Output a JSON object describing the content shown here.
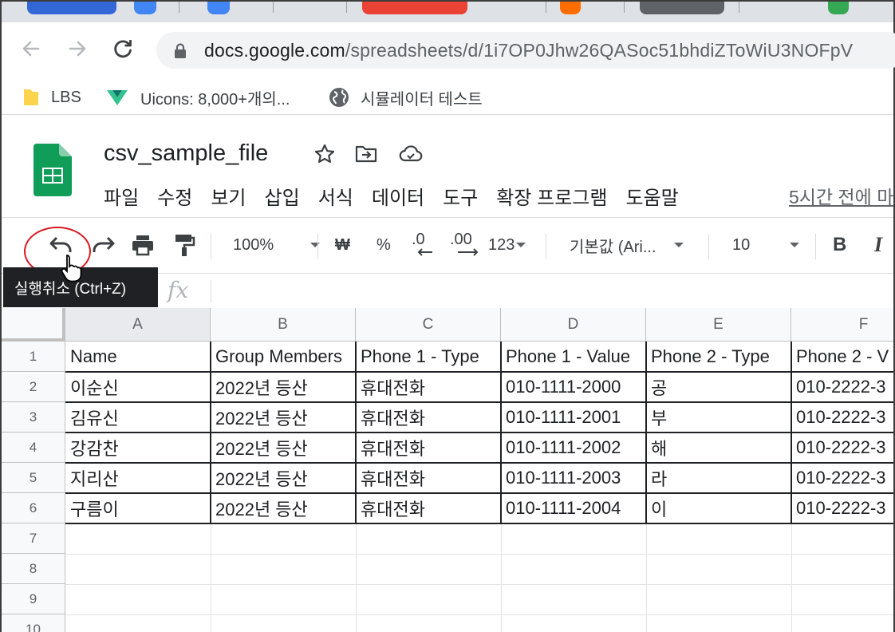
{
  "browser": {
    "url_host": "docs.google.com",
    "url_path": "/spreadsheets/d/1i7OP0Jhw26QASoc51bhdiZToWiU3NOFpV",
    "bookmarks": [
      {
        "label": "LBS",
        "icon": "folder-icon"
      },
      {
        "label": "Uicons: 8,000+개의...",
        "icon": "uicons-icon"
      },
      {
        "label": "시뮬레이터 테스트",
        "icon": "globe-icon"
      }
    ]
  },
  "sheets": {
    "title": "csv_sample_file",
    "menu": [
      "파일",
      "수정",
      "보기",
      "삽입",
      "서식",
      "데이터",
      "도구",
      "확장 프로그램",
      "도움말"
    ],
    "last_edit": "5시간 전에 마",
    "toolbar": {
      "zoom": "100%",
      "currency": "₩",
      "percent": "%",
      "decrease_decimal": ".0",
      "increase_decimal": ".00",
      "more_formats": "123",
      "font": "기본값 (Ari...",
      "font_size": "10",
      "bold": "B",
      "italic": "I"
    },
    "tooltip": "실행취소 (Ctrl+Z)",
    "formula_icon": "fx"
  },
  "grid": {
    "columns": [
      "A",
      "B",
      "C",
      "D",
      "E",
      "F"
    ],
    "rows": [
      "1",
      "2",
      "3",
      "4",
      "5",
      "6",
      "7",
      "8",
      "9",
      "10"
    ],
    "cells": [
      [
        "Name",
        "Group Members",
        "Phone 1 - Type",
        "Phone 1 - Value",
        "Phone 2 - Type",
        "Phone 2 - V"
      ],
      [
        "이순신",
        "2022년 등산",
        "휴대전화",
        "010-1111-2000",
        "공",
        "010-2222-3"
      ],
      [
        "김유신",
        "2022년 등산",
        "휴대전화",
        "010-1111-2001",
        "부",
        "010-2222-3"
      ],
      [
        "강감찬",
        "2022년 등산",
        "휴대전화",
        "010-1111-2002",
        "해",
        "010-2222-3"
      ],
      [
        "지리산",
        "2022년 등산",
        "휴대전화",
        "010-1111-2003",
        "라",
        "010-2222-3"
      ],
      [
        "구름이",
        "2022년 등산",
        "휴대전화",
        "010-1111-2004",
        "이",
        "010-2222-3"
      ]
    ]
  },
  "colors": {
    "sheets_green": "#0f9d58",
    "highlight_red": "#d71920"
  }
}
